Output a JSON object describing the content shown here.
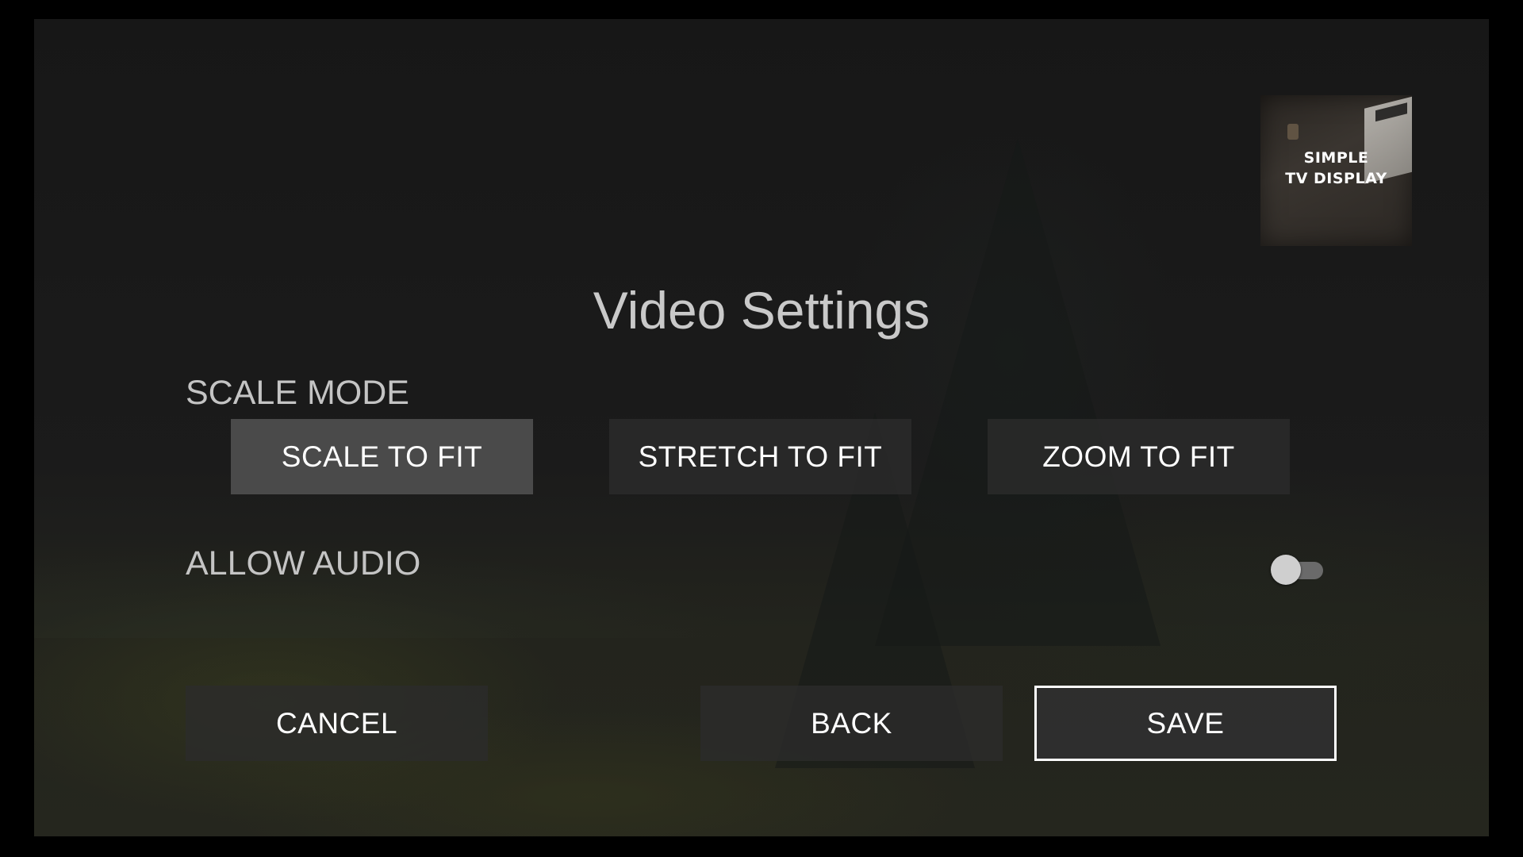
{
  "logo": {
    "line1": "SIMPLE",
    "line2": "TV DISPLAY"
  },
  "title": "Video Settings",
  "scale_mode": {
    "label": "SCALE MODE",
    "options": [
      "SCALE TO FIT",
      "STRETCH TO FIT",
      "ZOOM TO FIT"
    ],
    "selected": "SCALE TO FIT"
  },
  "allow_audio": {
    "label": "ALLOW AUDIO",
    "enabled": false
  },
  "actions": {
    "cancel": "CANCEL",
    "back": "BACK",
    "save": "SAVE",
    "focused": "SAVE"
  },
  "colors": {
    "background": "#1a1a1a",
    "text": "#c9c9c9",
    "button_bg": "#2c2c2c",
    "button_selected_bg": "#4a4a4a",
    "focus_border": "#ffffff"
  }
}
